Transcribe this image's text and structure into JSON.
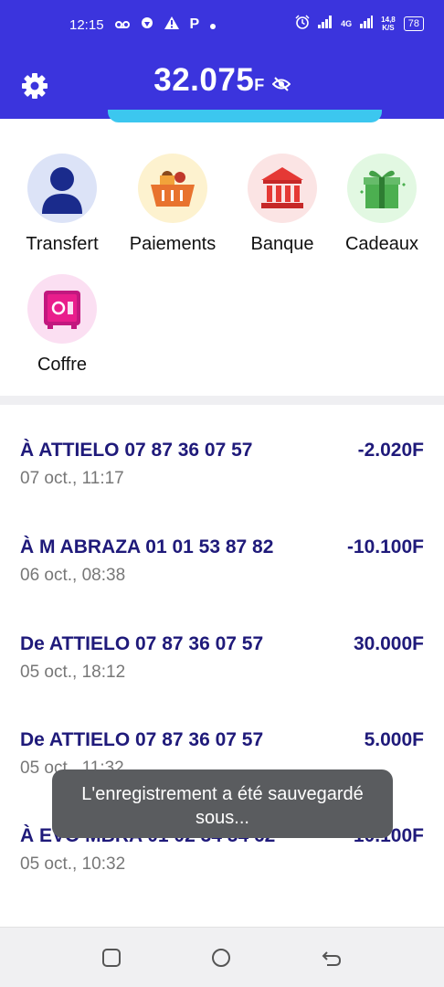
{
  "status_bar": {
    "time": "12:15",
    "network": "4G",
    "speed_value": "14,8",
    "speed_unit": "K/S",
    "battery": "78"
  },
  "header": {
    "balance_amount": "32.075",
    "balance_currency": "F",
    "colors": {
      "primary": "#3b34dd",
      "accent_strip": "#3cc7ef"
    }
  },
  "services": [
    {
      "label": "Transfert",
      "icon": "person-icon"
    },
    {
      "label": "Paiements",
      "icon": "basket-icon"
    },
    {
      "label": "Banque",
      "icon": "bank-icon"
    },
    {
      "label": "Cadeaux",
      "icon": "gift-icon"
    },
    {
      "label": "Coffre",
      "icon": "safe-icon"
    }
  ],
  "transactions": [
    {
      "desc": "À ATTIELO 07 87 36 07 57",
      "amount": "-2.020F",
      "date": "07 oct., 11:17"
    },
    {
      "desc": "À M ABRAZA 01 01 53 87 82",
      "amount": "-10.100F",
      "date": "06 oct., 08:38"
    },
    {
      "desc": "De ATTIELO 07 87 36 07 57",
      "amount": "30.000F",
      "date": "05 oct., 18:12"
    },
    {
      "desc": "De ATTIELO 07 87 36 07 57",
      "amount": "5.000F",
      "date": "05 oct., 11:32"
    },
    {
      "desc": "À EVO MBRA 01 02 34 54 62",
      "amount": "-10.100F",
      "date": "05 oct., 10:32"
    }
  ],
  "toast": {
    "message": "L'enregistrement a été sauvegardé sous..."
  }
}
